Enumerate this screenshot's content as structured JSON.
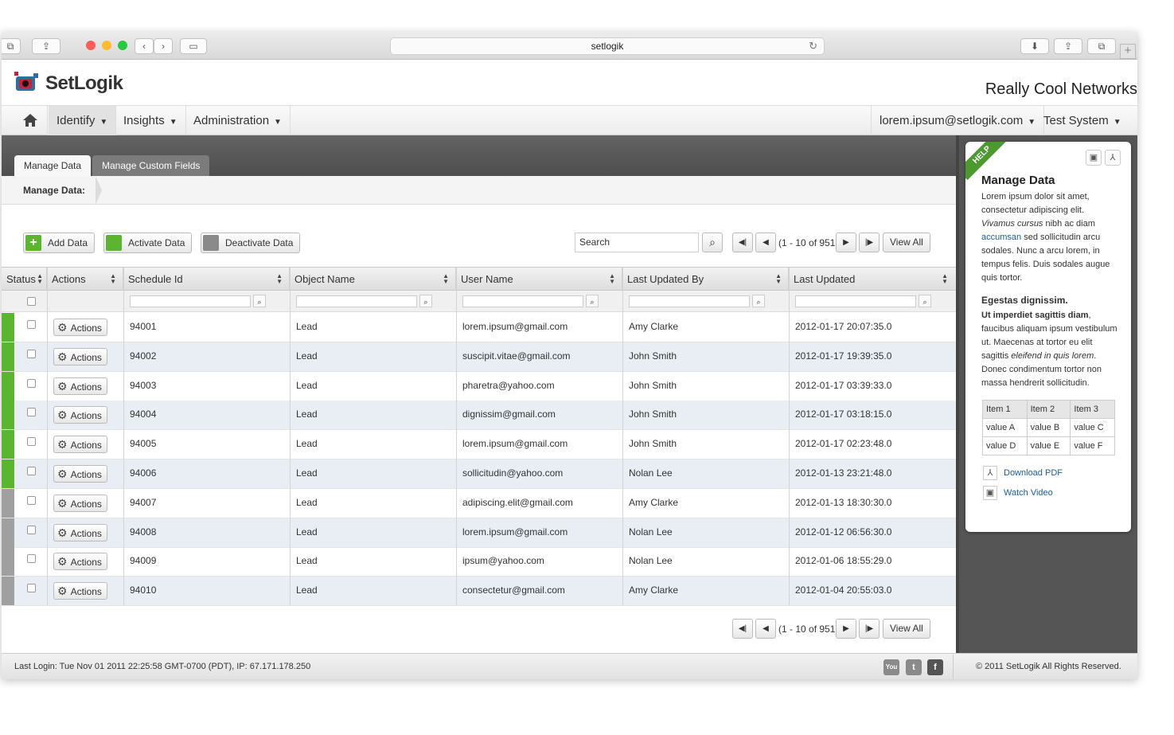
{
  "browser": {
    "url": "setlogik"
  },
  "header": {
    "brand": "SetLogik",
    "company": "Really Cool Networks"
  },
  "nav": {
    "items": [
      {
        "label": "Identify"
      },
      {
        "label": "Insights"
      },
      {
        "label": "Administration"
      }
    ],
    "user": "lorem.ipsum@setlogik.com",
    "system": "Test System"
  },
  "tabs": [
    "Manage Data",
    "Manage Custom Fields"
  ],
  "breadcrumb": "Manage Data:",
  "toolbar": {
    "add": "Add Data",
    "activate": "Activate Data",
    "deactivate": "Deactivate Data",
    "search_value": "Search",
    "page_info": "(1 - 10 of 951)",
    "view_all": "View All"
  },
  "table": {
    "columns": [
      "Status",
      "Actions",
      "Schedule Id",
      "Object Name",
      "User Name",
      "Last Updated By",
      "Last Updated"
    ],
    "action_label": "Actions",
    "rows": [
      {
        "status": "active",
        "id": "94001",
        "object": "Lead",
        "user": "lorem.ipsum@gmail.com",
        "by": "Amy Clarke",
        "updated": "2012-01-17 20:07:35.0"
      },
      {
        "status": "active",
        "id": "94002",
        "object": "Lead",
        "user": "suscipit.vitae@gmail.com",
        "by": "John Smith",
        "updated": "2012-01-17 19:39:35.0"
      },
      {
        "status": "active",
        "id": "94003",
        "object": "Lead",
        "user": "pharetra@yahoo.com",
        "by": "John Smith",
        "updated": "2012-01-17 03:39:33.0"
      },
      {
        "status": "active",
        "id": "94004",
        "object": "Lead",
        "user": "dignissim@gmail.com",
        "by": "John Smith",
        "updated": "2012-01-17 03:18:15.0"
      },
      {
        "status": "active",
        "id": "94005",
        "object": "Lead",
        "user": "lorem.ipsum@gmail.com",
        "by": "John Smith",
        "updated": "2012-01-17 02:23:48.0"
      },
      {
        "status": "active",
        "id": "94006",
        "object": "Lead",
        "user": "sollicitudin@yahoo.com",
        "by": "Nolan Lee",
        "updated": "2012-01-13 23:21:48.0"
      },
      {
        "status": "inactive",
        "id": "94007",
        "object": "Lead",
        "user": "adipiscing.elit@gmail.com",
        "by": "Amy Clarke",
        "updated": "2012-01-13 18:30:30.0"
      },
      {
        "status": "inactive",
        "id": "94008",
        "object": "Lead",
        "user": "lorem.ipsum@gmail.com",
        "by": "Nolan Lee",
        "updated": "2012-01-12 06:56:30.0"
      },
      {
        "status": "inactive",
        "id": "94009",
        "object": "Lead",
        "user": "ipsum@yahoo.com",
        "by": "Nolan Lee",
        "updated": "2012-01-06 18:55:29.0"
      },
      {
        "status": "inactive",
        "id": "94010",
        "object": "Lead",
        "user": "consectetur@gmail.com",
        "by": "Amy Clarke",
        "updated": "2012-01-04 20:55:03.0"
      }
    ]
  },
  "help": {
    "ribbon": "HELP",
    "title": "Manage Data",
    "p1_a": "Lorem ipsum dolor sit amet, consectetur adipiscing elit. ",
    "p1_b": "Vivamus cursus",
    "p1_c": " nibh ac diam ",
    "p1_link": "accumsan",
    "p1_d": " sed sollicitudin arcu sodales. Nunc a arcu lorem, in tempus felis. Duis sodales augue quis tortor.",
    "subtitle": "Egestas dignissim.",
    "p2_a": "Ut imperdiet sagittis diam",
    "p2_b": ", faucibus aliquam ipsum vestibulum ut. Maecenas at tortor eu elit sagittis ",
    "p2_c": "eleifend in quis lorem",
    "p2_d": ". Donec condimentum tortor non massa hendrerit sollicitudin.",
    "table": [
      [
        "Item 1",
        "Item 2",
        "Item 3"
      ],
      [
        "value A",
        "value B",
        "value C"
      ],
      [
        "value D",
        "value E",
        "value F"
      ]
    ],
    "download": "Download PDF",
    "video": "Watch Video"
  },
  "footer": {
    "last_login": "Last Login: Tue Nov 01 2011 22:25:58 GMT-0700 (PDT), IP: 67.171.178.250",
    "copyright": "© 2011 SetLogik All Rights Reserved."
  },
  "colors": {
    "active_status": "#5cb531",
    "inactive_status": "#a0a0a0",
    "link": "#1a5d99",
    "help_ribbon": "#4a9a2e"
  }
}
